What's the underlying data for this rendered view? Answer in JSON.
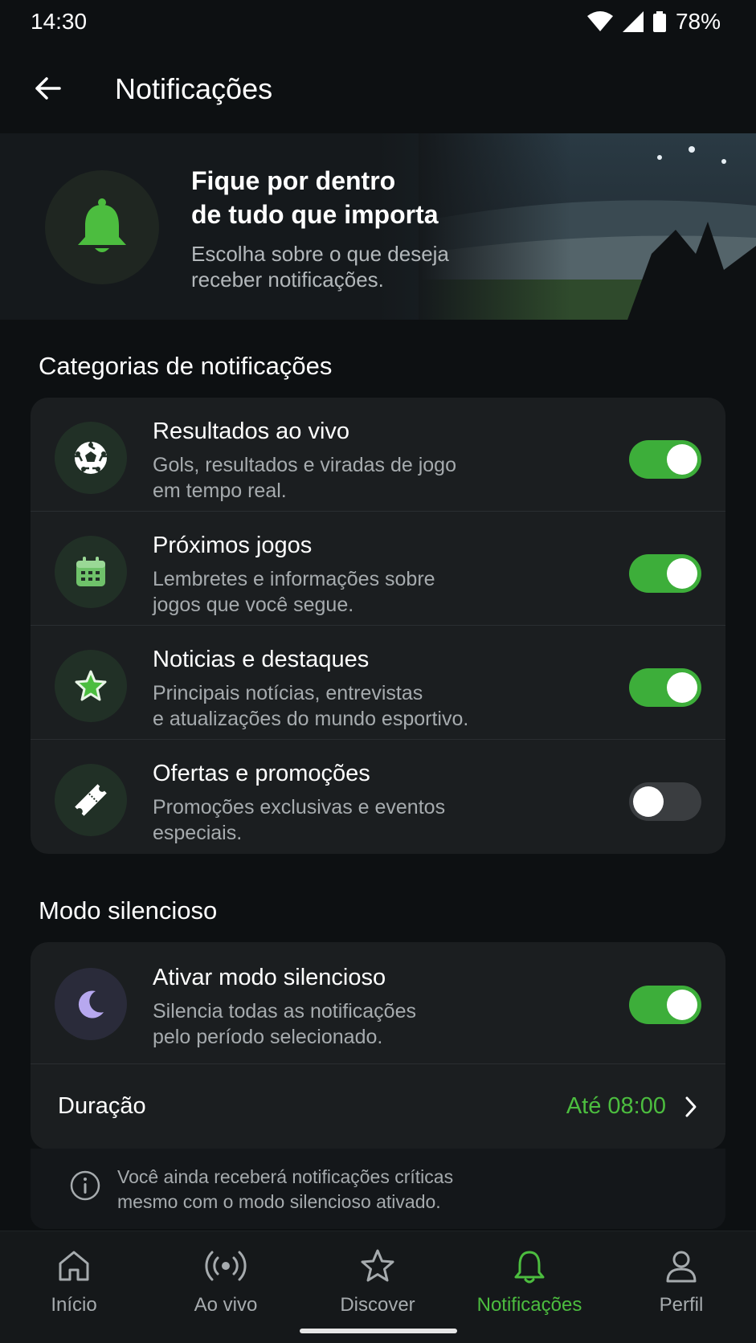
{
  "status_bar": {
    "time": "14:30",
    "battery": "78%"
  },
  "app_bar": {
    "title": "Notificações"
  },
  "hero": {
    "title_line1": "Fique por dentro",
    "title_line2": "de tudo que importa",
    "subtitle_line1": "Escolha sobre o que deseja",
    "subtitle_line2": "receber notificações."
  },
  "categories": {
    "title": "Categorias de notificações",
    "items": [
      {
        "title": "Resultados ao vivo",
        "desc1": "Gols, resultados e viradas de jogo",
        "desc2": "em tempo real.",
        "icon": "soccer-ball-icon",
        "enabled": true
      },
      {
        "title": "Próximos jogos",
        "desc1": "Lembretes e informações sobre",
        "desc2": "jogos que você segue.",
        "icon": "calendar-icon",
        "enabled": true
      },
      {
        "title": "Noticias e destaques",
        "desc1": "Principais notícias, entrevistas",
        "desc2": "e atualizações do mundo esportivo.",
        "icon": "star-icon",
        "enabled": true
      },
      {
        "title": "Ofertas e promoções",
        "desc1": "Promoções exclusivas e eventos",
        "desc2": "especiais.",
        "icon": "ticket-icon",
        "enabled": false
      }
    ]
  },
  "silent_mode": {
    "title": "Modo silencioso",
    "toggle_title": "Ativar modo silencioso",
    "toggle_desc1": "Silencia todas as notificações",
    "toggle_desc2": "pelo período selecionado.",
    "enabled": true,
    "duration_label": "Duração",
    "duration_value": "Até 08:00"
  },
  "info": {
    "line1": "Você ainda receberá notificações críticas",
    "line2": "mesmo com o modo silencioso ativado."
  },
  "bottom_nav": {
    "items": [
      {
        "label": "Início",
        "icon": "home-icon"
      },
      {
        "label": "Ao vivo",
        "icon": "live-icon"
      },
      {
        "label": "Discover",
        "icon": "star-outline-icon"
      },
      {
        "label": "Notificações",
        "icon": "bell-icon"
      },
      {
        "label": "Perfil",
        "icon": "profile-icon"
      }
    ],
    "active_index": 3
  },
  "colors": {
    "accent": "#4cbd3f",
    "toggle_on": "#3dae3a",
    "card_bg": "#1b1e20",
    "page_bg": "#0d1012"
  }
}
